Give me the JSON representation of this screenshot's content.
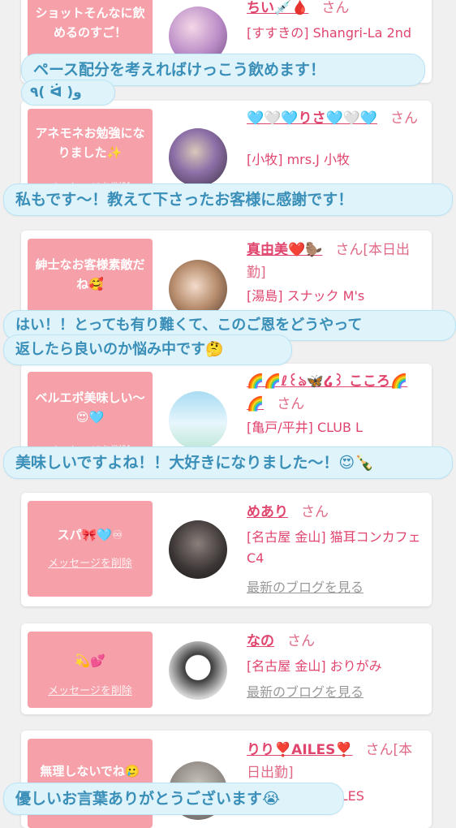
{
  "delete_label": "メッセージを削除",
  "blog_label": "最新のブログを見る",
  "san": "さん",
  "cards": [
    {
      "message": "ショットそんなに飲めるのすご！",
      "name": "ちい💉🩸",
      "shop": "[すすきの] Shangri-La 2nd"
    },
    {
      "message": "アネモネお勉強になりました✨",
      "name": "🩵🤍🩵りさ🩵🤍🩵",
      "shop": "[小牧] mrs.J 小牧"
    },
    {
      "message": "紳士なお客様素敵だね🥰",
      "name": "真由美❤️🦫",
      "tag": "[本日出勤]",
      "shop": "[湯島] スナック M's"
    },
    {
      "message": "ベルエポ美味しい〜😍🩵",
      "name": "🌈🌈ℓ꒰ঌ🦋໒꒱ こころ🌈🌈",
      "shop": "[亀戸/平井] CLUB L"
    },
    {
      "message": "スパ🎀🩵♾",
      "name": "めあり",
      "shop": "[名古屋 金山] 猫耳コンカフェ C4"
    },
    {
      "message": "💫💕",
      "name": "なの",
      "shop": "[名古屋 金山] おりがみ"
    },
    {
      "message": "無理しないでね🥲",
      "name": "りり❣️AILES❣️",
      "tag": "[本日出勤]",
      "shop": "AILES"
    }
  ],
  "bubbles": {
    "b1_line1": "ペース配分を考えればけっこう飲めます！",
    "b1_line2": "٩( ᐛ )و",
    "b2": "私もです〜！教えて下さったお客様に感謝です！",
    "b3_line1": "はい！！とっても有り難くて、このご恩をどうやって",
    "b3_line2": "返したら良いのか悩み中です🤔",
    "b4": "美味しいですよね！！大好きになりました〜！😍🍾",
    "b5": "優しいお言葉ありがとうございます😭"
  },
  "colors": {
    "pink_box": "#f6a1aa",
    "name_pink": "#e0456e",
    "bubble_bg": "#dff3fb",
    "bubble_text": "#3a8fb8"
  }
}
